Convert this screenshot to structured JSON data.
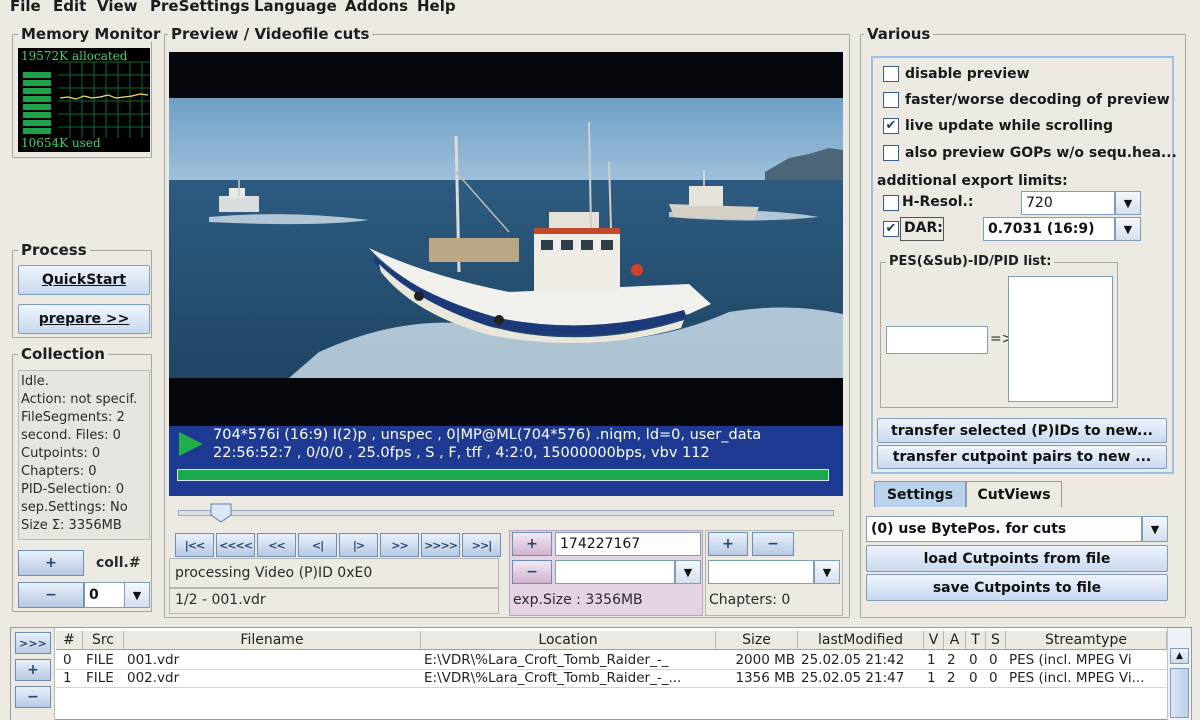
{
  "menu": [
    "File",
    "Edit",
    "View",
    "PreSettings",
    "Language",
    "Addons",
    "Help"
  ],
  "memory": {
    "title": "Memory Monitor",
    "allocated": "19572K allocated",
    "used": "10654K used"
  },
  "process": {
    "title": "Process",
    "quickstart": "QuickStart",
    "prepare": "prepare >>"
  },
  "collection": {
    "title": "Collection",
    "lines": [
      "Idle.",
      "Action: not specif.",
      "FileSegments: 2",
      "second. Files: 0",
      "Cutpoints: 0",
      "Chapters: 0",
      "PID-Selection: 0",
      "sep.Settings: No",
      "Size Σ: 3356MB"
    ],
    "add_label": "+",
    "remove_label": "−",
    "coll_label": "coll.#",
    "coll_value": "0"
  },
  "preview": {
    "title": "Preview / Videofile cuts",
    "info_line1": "704*576i (16:9) I(2)p , unspec , 0|MP@ML(704*576)  .niqm, ld=0, user_data",
    "info_line2": "22:56:52:7 , 0/0/0 , 25.0fps , S , F, tff , 4:2:0, 15000000bps, vbv 112",
    "progress": 1.0,
    "slider_fraction": 0.05,
    "nav_buttons": [
      "|<<",
      "<<<<",
      "<<",
      "<|",
      "|>",
      ">>",
      ">>>>",
      ">>|"
    ],
    "processing_label": "processing Video (P)ID 0xE0",
    "file_index": "1/2 - 001.vdr",
    "cut_value": "174227167",
    "exp_size": "exp.Size : 3356MB",
    "chapters": "Chapters:  0"
  },
  "various": {
    "title": "Various",
    "options": [
      {
        "label": "disable preview",
        "checked": ""
      },
      {
        "label": "faster/worse decoding of preview",
        "checked": ""
      },
      {
        "label": "live update while scrolling",
        "checked": "✔"
      },
      {
        "label": "also preview GOPs w/o sequ.hea...",
        "checked": ""
      }
    ],
    "export_limits": "additional export limits:",
    "hresol_label": "H-Resol.:",
    "hresol_checked": "",
    "hresol_value": "720",
    "dar_label": "DAR:",
    "dar_checked": "✔",
    "dar_value": "0.7031 (16:9)",
    "pes_title": "PES(&Sub)-ID/PID list:",
    "arrow": "=>",
    "transfer_pids": "transfer selected (P)IDs to new...",
    "transfer_cuts": "transfer cutpoint pairs to new ...",
    "tab_settings": "Settings",
    "tab_cutviews": "CutViews",
    "cut_mode": "(0) use BytePos. for cuts",
    "load_cutpoints": "load Cutpoints from file",
    "save_cutpoints": "save Cutpoints to file"
  },
  "table": {
    "side_buttons": [
      ">>>",
      "+",
      "−"
    ],
    "headers": [
      "#",
      "Src",
      "Filename",
      "Location",
      "Size",
      "lastModified",
      "V",
      "A",
      "T",
      "S",
      "Streamtype"
    ],
    "rows": [
      [
        "0",
        "FILE",
        "001.vdr",
        "E:\\VDR\\%Lara_Croft_Tomb_Raider_-_",
        "2000 MB",
        "25.02.05  21:42",
        "1",
        "2",
        "0",
        "0",
        "PES (incl. MPEG Vi"
      ],
      [
        "1",
        "FILE",
        "002.vdr",
        "E:\\VDR\\%Lara_Croft_Tomb_Raider_-_...",
        "1356 MB",
        "25.02.05  21:47",
        "1",
        "2",
        "0",
        "0",
        "PES (incl. MPEG Vi..."
      ]
    ]
  },
  "colors": {
    "accent": "#1f3a93",
    "progress": "#1aa84a",
    "play": "#22b04a",
    "panel": "#ece9e3"
  }
}
